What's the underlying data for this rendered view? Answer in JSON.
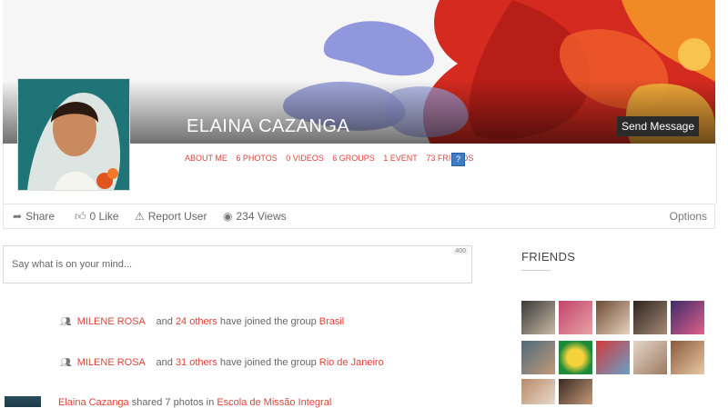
{
  "profile": {
    "name": "ELAINA CAZANGA",
    "send_message_label": "Send Message"
  },
  "tabs": [
    {
      "label": "ABOUT ME"
    },
    {
      "label": "6 PHOTOS"
    },
    {
      "label": "0 VIDEOS"
    },
    {
      "label": "6 GROUPS"
    },
    {
      "label": "1 EVENT"
    },
    {
      "label": "73 FRIENDS"
    }
  ],
  "info_icon": "?",
  "actions": {
    "share": "Share",
    "like": "0 Like",
    "report": "Report User",
    "views": "234 Views",
    "options": "Options"
  },
  "composer": {
    "placeholder": "Say what is on your mind...",
    "char_limit": "400"
  },
  "friends": {
    "title": "FRIENDS"
  },
  "feed": [
    {
      "actor": "MILENE ROSA",
      "and_text": "and",
      "others": "24 others",
      "text": "have joined the group",
      "group": "Brasil"
    },
    {
      "actor": "MILENE ROSA",
      "and_text": "and",
      "others": "31 others",
      "text": "have joined the group",
      "group": "Rio de Janeiro"
    },
    {
      "actor": "Elaina Cazanga",
      "text": "shared 7 photos in",
      "group": "Escola de Missão Integral"
    }
  ],
  "colors": {
    "accent": "#d9453a",
    "button_dark": "#2b2b2b",
    "info_blue": "#3f7cc6"
  },
  "icons": {
    "share": "share-icon",
    "like": "thumbs-up-icon",
    "report": "warning-icon",
    "views": "eye-icon",
    "group": "users-icon"
  }
}
